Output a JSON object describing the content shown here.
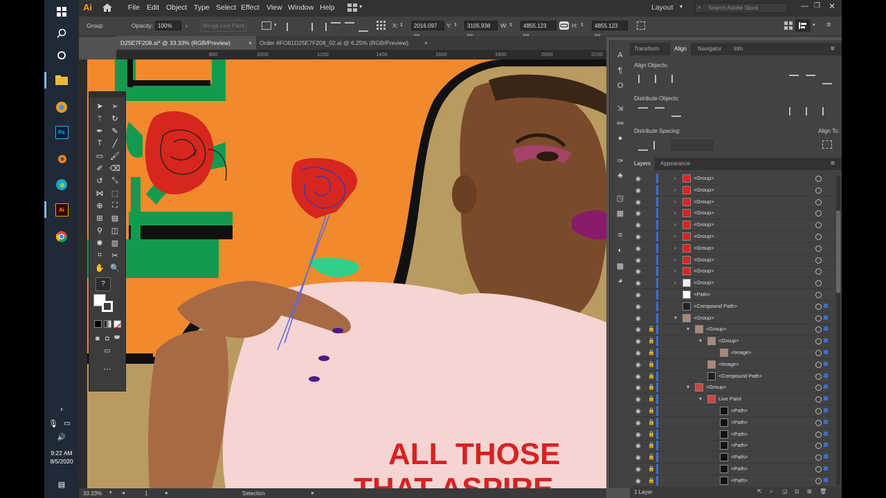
{
  "taskbar": {
    "icons": [
      "windows-start-icon",
      "search-icon",
      "task-view-icon",
      "file-explorer-icon",
      "chrome-canary-icon",
      "photoshop-icon",
      "blender-icon",
      "edge-icon",
      "illustrator-icon",
      "chrome-icon"
    ],
    "ps_label": "Ps",
    "ai_label": "Ai",
    "time": "9:22 AM",
    "date": "8/5/2020"
  },
  "menubar": {
    "logo": "Ai",
    "items": [
      "File",
      "Edit",
      "Object",
      "Type",
      "Select",
      "Effect",
      "View",
      "Window",
      "Help"
    ],
    "workspace": "Layout",
    "search_placeholder": "Search Adobe Stock"
  },
  "control": {
    "selection_type": "Group",
    "opacity_label": "Opacity:",
    "opacity_value": "100%",
    "merge_live_paint": "Merge Live Paint",
    "x_label": "X:",
    "x_value": "2016.097 px",
    "y_label": "Y:",
    "y_value": "3105.938 px",
    "w_label": "W:",
    "w_value": "4855.123 px",
    "h_label": "H:",
    "h_value": "4855.123 px"
  },
  "tabs": [
    {
      "label": "D25E7F208.ai* @ 33.33% (RGB/Preview)",
      "active": true
    },
    {
      "label": "Order #FO81D25E7F208_02.ai @ 6.25% (RGB/Preview)",
      "active": false
    }
  ],
  "ruler": {
    "ticks": [
      "800",
      "1000",
      "1200",
      "1400",
      "1600",
      "1800",
      "2000",
      "2200"
    ]
  },
  "canvas": {
    "shirt_line1": "ALL THOSE",
    "shirt_line2": "THAT ASPIRE"
  },
  "status": {
    "zoom": "33.33%",
    "artboard": "1",
    "mode": "Selection"
  },
  "panel_tabs": [
    "Transform",
    "Align",
    "Navigator",
    "Info"
  ],
  "align": {
    "align_objects": "Align Objects:",
    "distribute_objects": "Distribute Objects:",
    "distribute_spacing": "Distribute Spacing:",
    "align_to": "Align To:"
  },
  "layers_tabs": [
    "Layers",
    "Appearance"
  ],
  "layers": [
    {
      "name": "<Group>",
      "indent": 0,
      "thumb": "#d22"
    },
    {
      "name": "<Group>",
      "indent": 0,
      "thumb": "#d22"
    },
    {
      "name": "<Group>",
      "indent": 0,
      "thumb": "#d22"
    },
    {
      "name": "<Group>",
      "indent": 0,
      "thumb": "#d22"
    },
    {
      "name": "<Group>",
      "indent": 0,
      "thumb": "#d22"
    },
    {
      "name": "<Group>",
      "indent": 0,
      "thumb": "#d22"
    },
    {
      "name": "<Group>",
      "indent": 0,
      "thumb": "#d22"
    },
    {
      "name": "<Group>",
      "indent": 0,
      "thumb": "#d22"
    },
    {
      "name": "<Group>",
      "indent": 0,
      "thumb": "#d22"
    },
    {
      "name": "<Group>",
      "indent": 0,
      "thumb": "#eee"
    },
    {
      "name": "<Path>",
      "indent": 0,
      "thumb": "#fff"
    },
    {
      "name": "<Compound Path>",
      "indent": 0,
      "thumb": "#222"
    },
    {
      "name": "<Group>",
      "indent": 0,
      "thumb": "#a87"
    },
    {
      "name": "<Group>",
      "indent": 1,
      "thumb": "#a87"
    },
    {
      "name": "<Group>",
      "indent": 2,
      "thumb": "#a87"
    },
    {
      "name": "<Image>",
      "indent": 3,
      "thumb": "#a87"
    },
    {
      "name": "<Image>",
      "indent": 2,
      "thumb": "#a87"
    },
    {
      "name": "<Compound Path>",
      "indent": 2,
      "thumb": "#222"
    },
    {
      "name": "<Group>",
      "indent": 1,
      "thumb": "#c44"
    },
    {
      "name": "Live Paint",
      "indent": 2,
      "thumb": "#c44"
    },
    {
      "name": "<Path>",
      "indent": 3,
      "thumb": "#111"
    },
    {
      "name": "<Path>",
      "indent": 3,
      "thumb": "#111"
    },
    {
      "name": "<Path>",
      "indent": 3,
      "thumb": "#111"
    },
    {
      "name": "<Path>",
      "indent": 3,
      "thumb": "#111"
    },
    {
      "name": "<Path>",
      "indent": 3,
      "thumb": "#111"
    },
    {
      "name": "<Path>",
      "indent": 3,
      "thumb": "#111"
    },
    {
      "name": "<Path>",
      "indent": 3,
      "thumb": "#111"
    }
  ],
  "layers_footer": "1 Layer"
}
